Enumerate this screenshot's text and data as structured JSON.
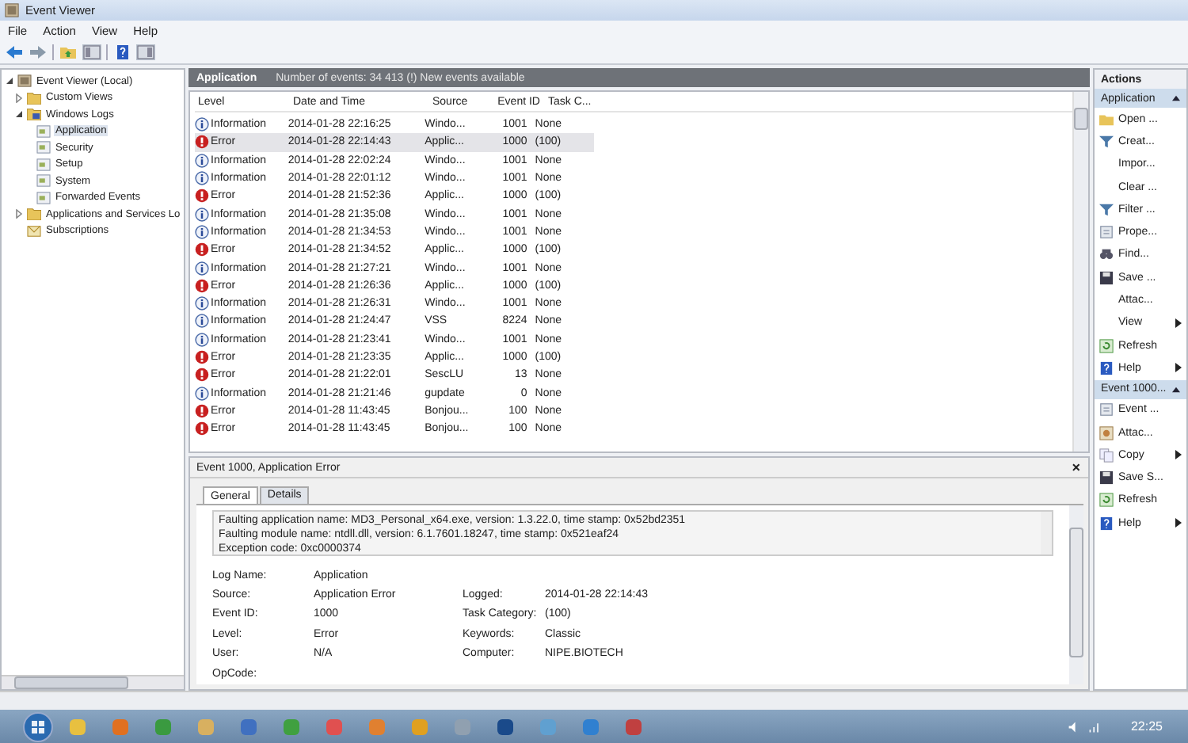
{
  "window": {
    "title": "Event Viewer"
  },
  "menu": [
    "File",
    "Action",
    "View",
    "Help"
  ],
  "tree": [
    {
      "label": "Event Viewer (Local)",
      "kind": "viewer",
      "expanded": true,
      "selected": false,
      "children": [
        {
          "label": "Custom Views",
          "kind": "folder",
          "expanded": false,
          "selected": false
        },
        {
          "label": "Windows Logs",
          "kind": "logs",
          "expanded": true,
          "selected": false,
          "children": [
            {
              "label": "Application",
              "kind": "log",
              "selected": true
            },
            {
              "label": "Security",
              "kind": "log",
              "selected": false
            },
            {
              "label": "Setup",
              "kind": "log",
              "selected": false
            },
            {
              "label": "System",
              "kind": "log",
              "selected": false
            },
            {
              "label": "Forwarded Events",
              "kind": "log",
              "selected": false
            }
          ]
        },
        {
          "label": "Applications and Services Lo",
          "kind": "folder",
          "expanded": false,
          "selected": false
        },
        {
          "label": "Subscriptions",
          "kind": "sub",
          "selected": false
        }
      ]
    }
  ],
  "log_header": {
    "title": "Application",
    "summary": "Number of events: 34 413 (!) New events available"
  },
  "table": {
    "columns": [
      "Level",
      "Date and Time",
      "Source",
      "Event ID",
      "Task C..."
    ],
    "rows": [
      {
        "kind": "info",
        "level": "Information",
        "date": "2014-01-28 22:16:25",
        "source": "Windo...",
        "event_id": "1001",
        "task": "None",
        "selected": false
      },
      {
        "kind": "error",
        "level": "Error",
        "date": "2014-01-28 22:14:43",
        "source": "Applic...",
        "event_id": "1000",
        "task": "(100)",
        "selected": true
      },
      {
        "kind": "info",
        "level": "Information",
        "date": "2014-01-28 22:02:24",
        "source": "Windo...",
        "event_id": "1001",
        "task": "None",
        "selected": false
      },
      {
        "kind": "info",
        "level": "Information",
        "date": "2014-01-28 22:01:12",
        "source": "Windo...",
        "event_id": "1001",
        "task": "None",
        "selected": false
      },
      {
        "kind": "error",
        "level": "Error",
        "date": "2014-01-28 21:52:36",
        "source": "Applic...",
        "event_id": "1000",
        "task": "(100)",
        "selected": false
      },
      {
        "kind": "info",
        "level": "Information",
        "date": "2014-01-28 21:35:08",
        "source": "Windo...",
        "event_id": "1001",
        "task": "None",
        "selected": false
      },
      {
        "kind": "info",
        "level": "Information",
        "date": "2014-01-28 21:34:53",
        "source": "Windo...",
        "event_id": "1001",
        "task": "None",
        "selected": false
      },
      {
        "kind": "error",
        "level": "Error",
        "date": "2014-01-28 21:34:52",
        "source": "Applic...",
        "event_id": "1000",
        "task": "(100)",
        "selected": false
      },
      {
        "kind": "info",
        "level": "Information",
        "date": "2014-01-28 21:27:21",
        "source": "Windo...",
        "event_id": "1001",
        "task": "None",
        "selected": false
      },
      {
        "kind": "error",
        "level": "Error",
        "date": "2014-01-28 21:26:36",
        "source": "Applic...",
        "event_id": "1000",
        "task": "(100)",
        "selected": false
      },
      {
        "kind": "info",
        "level": "Information",
        "date": "2014-01-28 21:26:31",
        "source": "Windo...",
        "event_id": "1001",
        "task": "None",
        "selected": false
      },
      {
        "kind": "info",
        "level": "Information",
        "date": "2014-01-28 21:24:47",
        "source": "VSS",
        "event_id": "8224",
        "task": "None",
        "selected": false
      },
      {
        "kind": "info",
        "level": "Information",
        "date": "2014-01-28 21:23:41",
        "source": "Windo...",
        "event_id": "1001",
        "task": "None",
        "selected": false
      },
      {
        "kind": "error",
        "level": "Error",
        "date": "2014-01-28 21:23:35",
        "source": "Applic...",
        "event_id": "1000",
        "task": "(100)",
        "selected": false
      },
      {
        "kind": "error",
        "level": "Error",
        "date": "2014-01-28 21:22:01",
        "source": "SescLU",
        "event_id": "13",
        "task": "None",
        "selected": false
      },
      {
        "kind": "info",
        "level": "Information",
        "date": "2014-01-28 21:21:46",
        "source": "gupdate",
        "event_id": "0",
        "task": "None",
        "selected": false
      },
      {
        "kind": "error",
        "level": "Error",
        "date": "2014-01-28 11:43:45",
        "source": "Bonjou...",
        "event_id": "100",
        "task": "None",
        "selected": false
      },
      {
        "kind": "error",
        "level": "Error",
        "date": "2014-01-28 11:43:45",
        "source": "Bonjou...",
        "event_id": "100",
        "task": "None",
        "selected": false
      }
    ]
  },
  "detail": {
    "title": "Event 1000, Application Error",
    "close": "×",
    "tabs": [
      {
        "label": "General",
        "selected": true
      },
      {
        "label": "Details",
        "selected": false
      }
    ],
    "description": [
      "Faulting application name: MD3_Personal_x64.exe, version: 1.3.22.0, time stamp: 0x52bd2351",
      "Faulting module name: ntdll.dll, version: 6.1.7601.18247, time stamp: 0x521eaf24",
      "Exception code: 0xc0000374"
    ],
    "fields_left": [
      {
        "label": "Log Name:",
        "value": "Application"
      },
      {
        "label": "Source:",
        "value": "Application Error"
      },
      {
        "label": "Event ID:",
        "value": "1000"
      },
      {
        "label": "Level:",
        "value": "Error"
      },
      {
        "label": "User:",
        "value": "N/A"
      },
      {
        "label": "OpCode:"
      }
    ],
    "fields_right": [
      {
        "label": "Logged:",
        "value": "2014-01-28 22:14:43"
      },
      {
        "label": "Task Category:",
        "value": "(100)"
      },
      {
        "label": "Keywords:",
        "value": "Classic"
      },
      {
        "label": "Computer:",
        "value": "NIPE.BIOTECH"
      }
    ]
  },
  "actions": {
    "title": "Actions",
    "sections": [
      {
        "title": "Application",
        "items": [
          {
            "label": "Open ...",
            "kind": "folder",
            "submenu": false
          },
          {
            "label": "Creat...",
            "kind": "funnel",
            "submenu": false
          },
          {
            "label": "Impor...",
            "kind": "plain",
            "submenu": false
          },
          {
            "label": "Clear ...",
            "kind": "plain",
            "submenu": false
          },
          {
            "label": "Filter ...",
            "kind": "funnel",
            "submenu": false
          },
          {
            "label": "Prope...",
            "kind": "props",
            "submenu": false
          },
          {
            "label": "Find...",
            "kind": "find",
            "submenu": false
          },
          {
            "label": "Save ...",
            "kind": "save",
            "submenu": false
          },
          {
            "label": "Attac...",
            "kind": "plain",
            "submenu": false
          },
          {
            "label": "View",
            "kind": "plain",
            "submenu": true
          },
          {
            "label": "Refresh",
            "kind": "refresh",
            "submenu": false
          },
          {
            "label": "Help",
            "kind": "help",
            "submenu": true
          }
        ]
      },
      {
        "title": "Event 1000...",
        "items": [
          {
            "label": "Event ...",
            "kind": "props",
            "submenu": false
          },
          {
            "label": "Attac...",
            "kind": "task",
            "submenu": false
          },
          {
            "label": "Copy",
            "kind": "copy",
            "submenu": true
          },
          {
            "label": "Save S...",
            "kind": "save",
            "submenu": false
          },
          {
            "label": "Refresh",
            "kind": "refresh",
            "submenu": false
          },
          {
            "label": "Help",
            "kind": "help",
            "submenu": true
          }
        ]
      }
    ]
  },
  "taskbar": {
    "clock": "22:25"
  }
}
